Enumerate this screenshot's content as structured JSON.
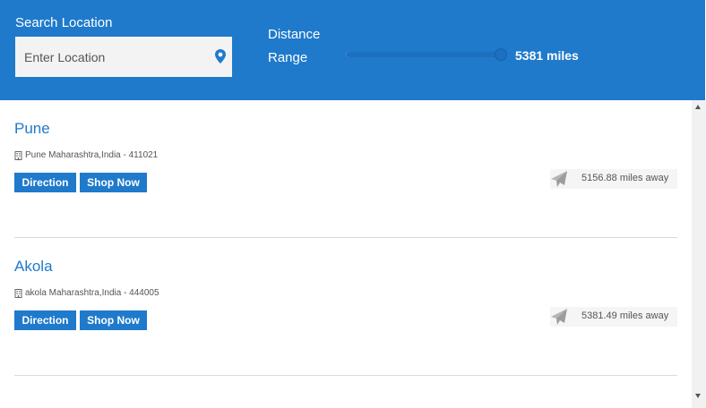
{
  "header": {
    "search_label": "Search Location",
    "search_placeholder": "Enter Location",
    "distance_label_line1": "Distance",
    "distance_label_line2": "Range",
    "range_value": "5381 miles",
    "range_fraction": 0.97,
    "colors": {
      "bar_bg": "#1f7acb",
      "slider": "#1d6fc0"
    }
  },
  "stores": [
    {
      "name": "Pune",
      "address": "Pune Maharashtra,India - 411021",
      "direction_label": "Direction",
      "shop_label": "Shop Now",
      "distance": "5156.88 miles away"
    },
    {
      "name": "Akola",
      "address": "akola Maharashtra,India - 444005",
      "direction_label": "Direction",
      "shop_label": "Shop Now",
      "distance": "5381.49 miles away"
    }
  ],
  "icons": {
    "pin": "map-pin-icon",
    "building": "building-icon",
    "plane": "paper-plane-icon"
  }
}
